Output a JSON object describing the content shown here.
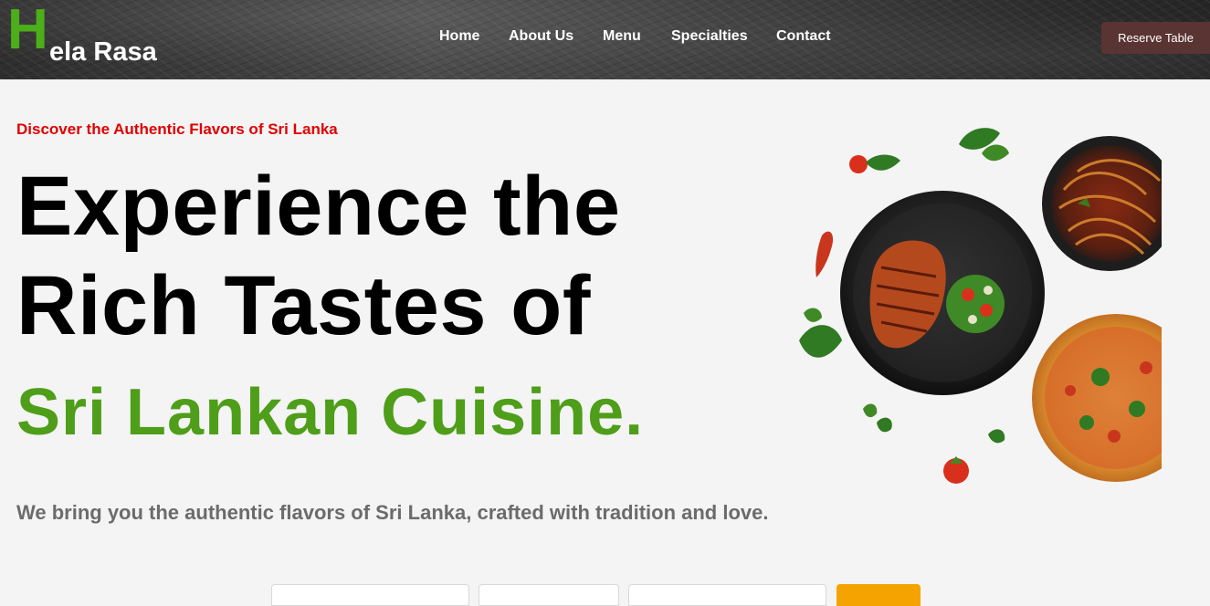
{
  "brand": {
    "initial": "H",
    "rest": "ela Rasa"
  },
  "nav": {
    "items": [
      {
        "label": "Home"
      },
      {
        "label": "About Us"
      },
      {
        "label": "Menu"
      },
      {
        "label": "Specialties"
      },
      {
        "label": "Contact"
      }
    ],
    "cta_label": "Reserve Table"
  },
  "hero": {
    "eyebrow": "Discover the Authentic Flavors of Sri Lanka",
    "title_line1": "Experience the",
    "title_line2": "Rich Tastes of",
    "title_highlight": "Sri Lankan Cuisine.",
    "subtitle": "We bring you the authentic flavors of Sri Lanka, crafted with tradition and love.",
    "image_icon": "food-platter-image"
  },
  "colors": {
    "brand_green": "#4caf1a",
    "highlight_green": "#4e9e19",
    "eyebrow_red": "#e00000",
    "cta_bg": "#5a3433",
    "form_button": "#f5a300"
  }
}
